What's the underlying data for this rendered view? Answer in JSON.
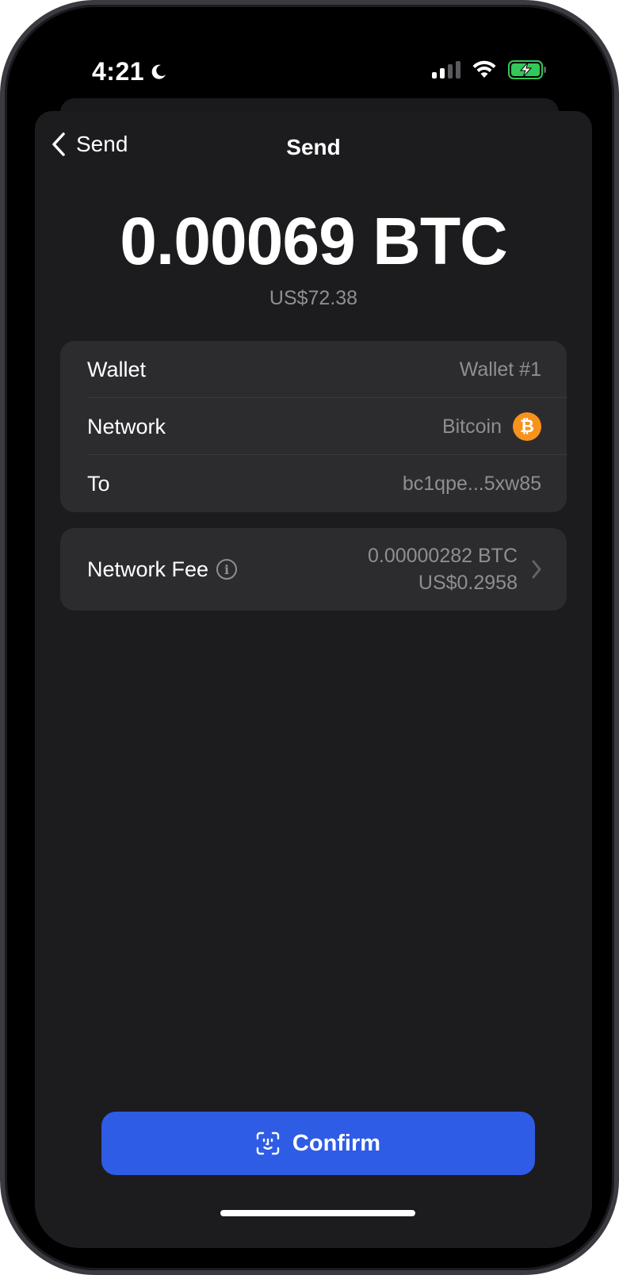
{
  "status_bar": {
    "time": "4:21"
  },
  "nav": {
    "back_label": "Send",
    "title": "Send"
  },
  "amount": {
    "crypto": "0.00069 BTC",
    "fiat": "US$72.38"
  },
  "details": {
    "wallet_label": "Wallet",
    "wallet_value": "Wallet #1",
    "network_label": "Network",
    "network_value": "Bitcoin",
    "to_label": "To",
    "to_value": "bc1qpe...5xw85"
  },
  "fee": {
    "label": "Network Fee",
    "crypto": "0.00000282 BTC",
    "fiat": "US$0.2958"
  },
  "confirm": {
    "label": "Confirm"
  },
  "colors": {
    "accent": "#2f5ce5",
    "bitcoin": "#f7931a",
    "battery": "#34c759",
    "background": "#1c1c1e",
    "card": "#2c2c2e"
  }
}
